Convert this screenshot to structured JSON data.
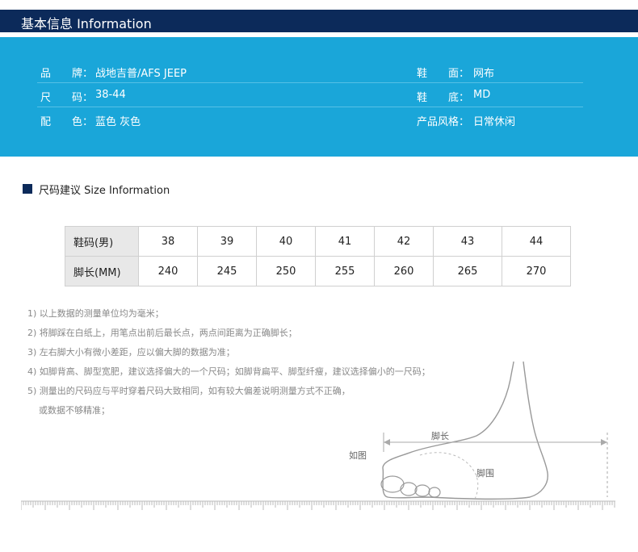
{
  "header": {
    "title": "基本信息 Information"
  },
  "info_rows": [
    {
      "left_label": "品　　牌：",
      "left_value": "战地吉普/AFS JEEP",
      "right_label": "鞋　　面：",
      "right_value": "网布"
    },
    {
      "left_label": "尺　　码：",
      "left_value": "38-44",
      "right_label": "鞋　　底：",
      "right_value": "MD"
    },
    {
      "left_label": "配　　色：",
      "left_value": "蓝色 灰色",
      "right_label": "产品风格：",
      "right_value": "日常休闲"
    }
  ],
  "size_section": {
    "title": "尺码建议 Size Information"
  },
  "size_table": {
    "rows": [
      {
        "label": "鞋码(男)",
        "values": [
          "38",
          "39",
          "40",
          "41",
          "42",
          "43",
          "44"
        ]
      },
      {
        "label": "脚长(MM)",
        "values": [
          "240",
          "245",
          "250",
          "255",
          "260",
          "265",
          "270"
        ]
      }
    ]
  },
  "notes": [
    "1) 以上数据的测量单位均为毫米；",
    "2) 将脚踩在白纸上，用笔点出前后最长点，两点间距离为正确脚长；",
    "3) 左右脚大小有微小差距，应以偏大脚的数据为准；",
    "4) 如脚背高、脚型宽肥，建议选择偏大的一个尺码；如脚背扁平、脚型纤瘦，建议选择偏小的一尺码；",
    "5) 测量出的尺码应与平时穿着尺码大致相同，如有较大偏差说明测量方式不正确，",
    "    或数据不够精准；"
  ],
  "diagram": {
    "example_label": "如图",
    "length_label": "脚长",
    "girth_label": "脚围"
  },
  "colors": {
    "header_bg": "#0c2a5a",
    "panel_bg": "#1aa6d9"
  }
}
